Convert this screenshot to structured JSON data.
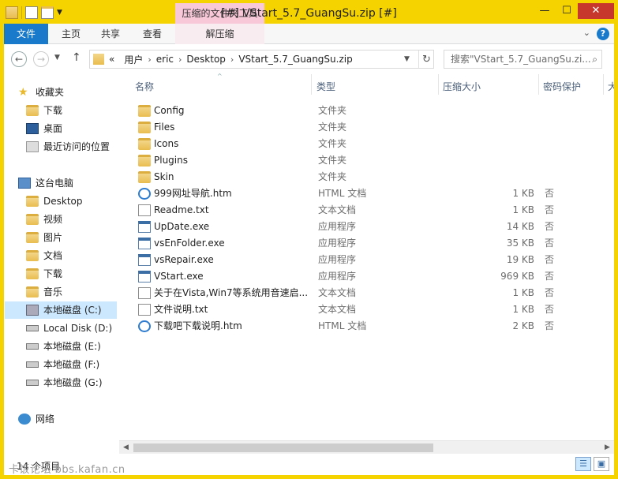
{
  "window": {
    "title": "[#] VStart_5.7_GuangSu.zip [#]",
    "context_tab_group": "压缩的文件夹工具",
    "buttons": {
      "minimize": "—",
      "maximize": "☐",
      "close": "✕"
    }
  },
  "ribbon": {
    "tabs": [
      {
        "label": "文件"
      },
      {
        "label": "主页"
      },
      {
        "label": "共享"
      },
      {
        "label": "查看"
      },
      {
        "label": "解压缩"
      }
    ]
  },
  "navigation": {
    "back": "←",
    "forward": "→",
    "up": "↑",
    "breadcrumb": [
      "«",
      "用户",
      "eric",
      "Desktop",
      "VStart_5.7_GuangSu.zip"
    ],
    "search_placeholder": "搜索\"VStart_5.7_GuangSu.zi..."
  },
  "sidebar": {
    "favorites": {
      "label": "收藏夹",
      "items": [
        "下载",
        "桌面",
        "最近访问的位置"
      ]
    },
    "this_pc": {
      "label": "这台电脑",
      "items": [
        "Desktop",
        "视频",
        "图片",
        "文档",
        "下载",
        "音乐",
        "本地磁盘 (C:)",
        "Local Disk (D:)",
        "本地磁盘 (E:)",
        "本地磁盘 (F:)",
        "本地磁盘 (G:)"
      ]
    },
    "network": {
      "label": "网络"
    }
  },
  "columns": {
    "name": "名称",
    "type": "类型",
    "size": "压缩大小",
    "protected": "密码保护",
    "extra": "大"
  },
  "files": [
    {
      "name": "Config",
      "type": "文件夹",
      "size": "",
      "protected": "",
      "icon": "folder"
    },
    {
      "name": "Files",
      "type": "文件夹",
      "size": "",
      "protected": "",
      "icon": "folder"
    },
    {
      "name": "Icons",
      "type": "文件夹",
      "size": "",
      "protected": "",
      "icon": "folder"
    },
    {
      "name": "Plugins",
      "type": "文件夹",
      "size": "",
      "protected": "",
      "icon": "folder"
    },
    {
      "name": "Skin",
      "type": "文件夹",
      "size": "",
      "protected": "",
      "icon": "folder"
    },
    {
      "name": "999网址导航.htm",
      "type": "HTML 文档",
      "size": "1 KB",
      "protected": "否",
      "icon": "ie"
    },
    {
      "name": "Readme.txt",
      "type": "文本文档",
      "size": "1 KB",
      "protected": "否",
      "icon": "doc"
    },
    {
      "name": "UpDate.exe",
      "type": "应用程序",
      "size": "14 KB",
      "protected": "否",
      "icon": "exe"
    },
    {
      "name": "vsEnFolder.exe",
      "type": "应用程序",
      "size": "35 KB",
      "protected": "否",
      "icon": "exe"
    },
    {
      "name": "vsRepair.exe",
      "type": "应用程序",
      "size": "19 KB",
      "protected": "否",
      "icon": "exe"
    },
    {
      "name": "VStart.exe",
      "type": "应用程序",
      "size": "969 KB",
      "protected": "否",
      "icon": "exe"
    },
    {
      "name": "关于在Vista,Win7等系统用音速启...",
      "type": "文本文档",
      "size": "1 KB",
      "protected": "否",
      "icon": "doc"
    },
    {
      "name": "文件说明.txt",
      "type": "文本文档",
      "size": "1 KB",
      "protected": "否",
      "icon": "doc"
    },
    {
      "name": "下载吧下载说明.htm",
      "type": "HTML 文档",
      "size": "2 KB",
      "protected": "否",
      "icon": "ie"
    }
  ],
  "status": {
    "item_count": "14 个项目",
    "watermark": "卡饭论坛 bbs.kafan.cn"
  },
  "colors": {
    "accent": "#1979ca",
    "title_bar": "#f5d300",
    "context_tab": "#f8c7d8",
    "selection": "#cce8ff"
  }
}
